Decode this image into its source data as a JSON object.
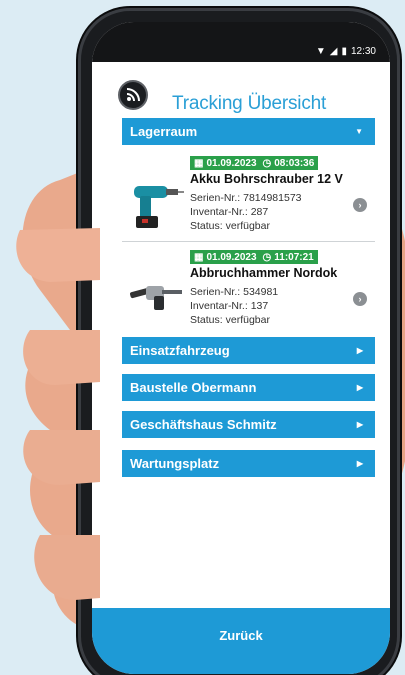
{
  "status_bar": {
    "time": "12:30"
  },
  "header": {
    "title": "Tracking Übersicht",
    "logo_icon": "signal-icon"
  },
  "sections": [
    {
      "label": "Lagerraum",
      "expanded": true,
      "arrow_icon": "caret-down-icon"
    },
    {
      "label": "Einsatzfahrzeug",
      "expanded": false,
      "arrow_icon": "caret-right-icon"
    },
    {
      "label": "Baustelle Obermann",
      "expanded": false,
      "arrow_icon": "caret-right-icon"
    },
    {
      "label": "Geschäftshaus Schmitz",
      "expanded": false,
      "arrow_icon": "caret-right-icon"
    },
    {
      "label": "Wartungsplatz",
      "expanded": false,
      "arrow_icon": "caret-right-icon"
    }
  ],
  "items": [
    {
      "date": "01.09.2023",
      "time": "08:03:36",
      "name": "Akku Bohrschrauber 12 V",
      "serial": "Serien-Nr.: 7814981573",
      "inventory": "Inventar-Nr.: 287",
      "status": "Status: verfügbar",
      "image_icon": "cordless-drill-icon"
    },
    {
      "date": "01.09.2023",
      "time": "11:07:21",
      "name": "Abbruchhammer Nordok",
      "serial": "Serien-Nr.: 534981",
      "inventory": "Inventar-Nr.: 137",
      "status": "Status: verfügbar",
      "image_icon": "demolition-hammer-icon"
    }
  ],
  "footer": {
    "back_label": "Zurück"
  },
  "colors": {
    "accent": "#1e9ad6",
    "title": "#2a9fd6",
    "badge": "#2aa04a"
  }
}
